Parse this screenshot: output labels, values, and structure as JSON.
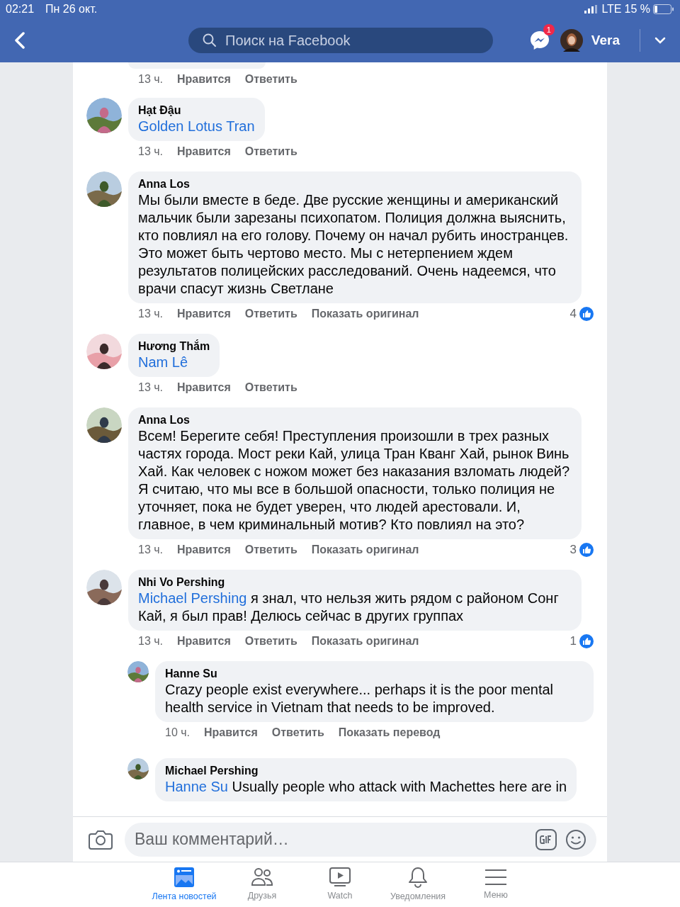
{
  "status_bar": {
    "time": "02:21",
    "date": "Пн 26 окт.",
    "network": "LTE",
    "battery": "15 %"
  },
  "header": {
    "search": {
      "placeholder": "Поиск на Facebook"
    },
    "messenger_badge": "1",
    "user": "Vera"
  },
  "comments": [
    {
      "kind": "fragment",
      "actions": [
        "13 ч.",
        "Нравится",
        "Ответить"
      ]
    },
    {
      "kind": "comment",
      "author": "Hạt Đậu",
      "mention": "Golden Lotus Tran",
      "actions": [
        "13 ч.",
        "Нравится",
        "Ответить"
      ]
    },
    {
      "kind": "comment",
      "author": "Anna Los",
      "text": "Мы были вместе в беде. Две русские женщины и американский мальчик были зарезаны психопатом. Полиция должна выяснить, кто повлиял на его голову. Почему он начал рубить иностранцев. Это может быть чертово место. Мы с нетерпением ждем результатов полицейских расследований. Очень надеемся, что врачи спасут жизнь Светлане",
      "actions": [
        "13 ч.",
        "Нравится",
        "Ответить",
        "Показать оригинал"
      ],
      "likes": "4"
    },
    {
      "kind": "comment",
      "author": "Hương Thắm",
      "mention": "Nam Lê",
      "actions": [
        "13 ч.",
        "Нравится",
        "Ответить"
      ]
    },
    {
      "kind": "comment",
      "author": "Anna Los",
      "text": "Всем! Берегите себя! Преступления произошли в трех разных частях города. Мост реки Кай, улица Тран Кванг Хай, рынок Винь Хай. Как человек с ножом может без наказания взломать людей? Я считаю, что мы все в большой опасности, только полиция не уточняет, пока не будет уверен, что людей арестовали. И, главное, в чем криминальный мотив? Кто повлиял на это?",
      "actions": [
        "13 ч.",
        "Нравится",
        "Ответить",
        "Показать оригинал"
      ],
      "likes": "3"
    },
    {
      "kind": "comment",
      "author": "Nhi Vo Pershing",
      "mention": "Michael Pershing",
      "text": "я знал, что нельзя жить рядом с районом Сонг Кай, я был прав! Делюсь сейчас в других группах",
      "actions": [
        "13 ч.",
        "Нравится",
        "Ответить",
        "Показать оригинал"
      ],
      "likes": "1",
      "replies": [
        {
          "kind": "comment",
          "author": "Hanne Su",
          "text": "Crazy people exist everywhere... perhaps it is the poor mental health service in Vietnam that needs to be improved.",
          "actions": [
            "10 ч.",
            "Нравится",
            "Ответить",
            "Показать перевод"
          ]
        },
        {
          "kind": "comment",
          "author": "Michael Pershing",
          "mention": "Hanne Su",
          "text": "Usually people who attack with Machettes here are in"
        }
      ]
    }
  ],
  "composer": {
    "placeholder": "Ваш комментарий…"
  },
  "nav": [
    {
      "label": "Лента новостей",
      "selected": true
    },
    {
      "label": "Друзья",
      "selected": false
    },
    {
      "label": "Watch",
      "selected": false
    },
    {
      "label": "Уведомления",
      "selected": false
    },
    {
      "label": "Меню",
      "selected": false
    }
  ]
}
